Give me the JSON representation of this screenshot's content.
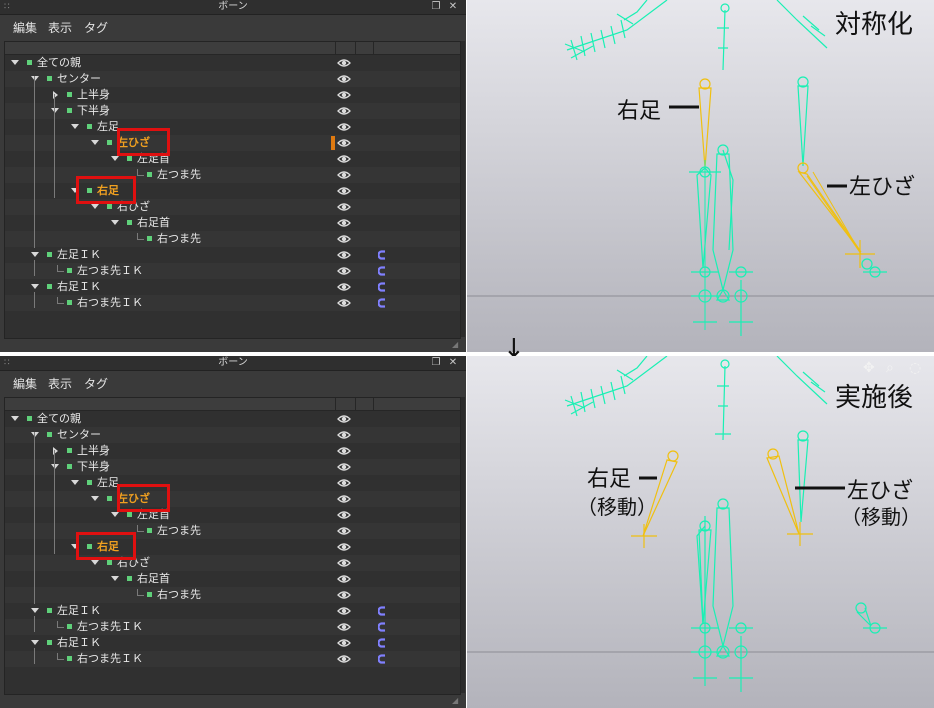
{
  "panel": {
    "title": "ボーン",
    "menu": [
      "編集",
      "表示",
      "タグ"
    ]
  },
  "bones": [
    {
      "label": "全ての親",
      "level": 0,
      "toggle": "down",
      "ik": false
    },
    {
      "label": "センター",
      "level": 1,
      "toggle": "down",
      "ik": false
    },
    {
      "label": "上半身",
      "level": 2,
      "toggle": "right",
      "ik": false
    },
    {
      "label": "下半身",
      "level": 2,
      "toggle": "down",
      "ik": false
    },
    {
      "label": "左足",
      "level": 3,
      "toggle": "down",
      "ik": false
    },
    {
      "label": "左ひざ",
      "level": 4,
      "toggle": "down",
      "ik": false
    },
    {
      "label": "左足首",
      "level": 5,
      "toggle": "down",
      "ik": false
    },
    {
      "label": "左つま先",
      "level": 6,
      "toggle": "none",
      "ik": false
    },
    {
      "label": "右足",
      "level": 3,
      "toggle": "down",
      "ik": false
    },
    {
      "label": "右ひざ",
      "level": 4,
      "toggle": "down",
      "ik": false
    },
    {
      "label": "右足首",
      "level": 5,
      "toggle": "down",
      "ik": false
    },
    {
      "label": "右つま先",
      "level": 6,
      "toggle": "none",
      "ik": false
    },
    {
      "label": "左足ＩＫ",
      "level": 1,
      "toggle": "down",
      "ik": true
    },
    {
      "label": "左つま先ＩＫ",
      "level": 2,
      "toggle": "none",
      "ik": true
    },
    {
      "label": "右足ＩＫ",
      "level": 1,
      "toggle": "down",
      "ik": true
    },
    {
      "label": "右つま先ＩＫ",
      "level": 2,
      "toggle": "none",
      "ik": true
    }
  ],
  "top": {
    "selected_bone": "左ひざ",
    "highlighted_bone": "右足",
    "caption": "対称化",
    "label_right_foot": "右足",
    "label_left_knee": "左ひざ"
  },
  "bottom": {
    "selected_bone": "左ひざ",
    "highlighted_bone": "右足",
    "caption": "実施後",
    "label_right_foot": "右足",
    "label_right_foot_note": "（移動）",
    "label_left_knee": "左ひざ",
    "label_left_knee_note": "（移動）"
  },
  "transition_arrow": "↓",
  "colors": {
    "panel_bg": "#3a3a3a",
    "bone_square": "#5fd07a",
    "selected_text": "#f0a020",
    "highlight_box": "#e01010",
    "bone_cyan": "#19f0b4",
    "bone_yellow": "#f0c010",
    "ik_icon": "#8080ff"
  },
  "icons": {
    "visibility": "eye-icon",
    "ik": "ik-magnet-icon"
  }
}
